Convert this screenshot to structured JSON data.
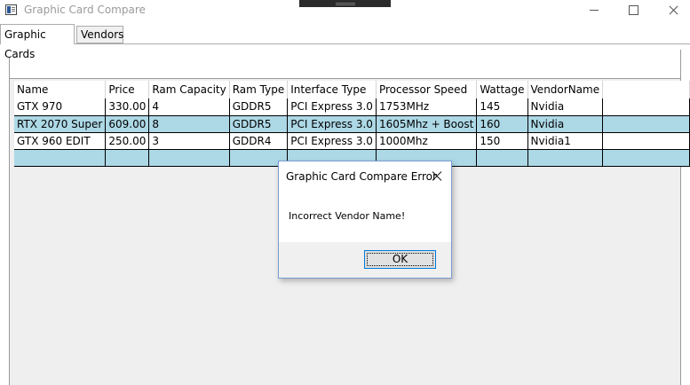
{
  "window": {
    "title": "Graphic Card Compare"
  },
  "tabs": [
    {
      "label": "Graphic Cards"
    },
    {
      "label": "Vendors"
    }
  ],
  "grid": {
    "columns": [
      "Name",
      "Price",
      "Ram Capacity",
      "Ram Type",
      "Interface Type",
      "Processor Speed",
      "Wattage",
      "VendorName"
    ],
    "rows": [
      [
        "GTX 970",
        "330.00",
        "4",
        "GDDR5",
        "PCI Express 3.0",
        "1753MHz",
        "145",
        "Nvidia"
      ],
      [
        "RTX 2070 Super",
        "609.00",
        "8",
        "GDDR5",
        "PCI Express 3.0",
        "1605Mhz + Boost",
        "160",
        "Nvidia"
      ],
      [
        "GTX 960 EDIT",
        "250.00",
        "3",
        "GDDR4",
        "PCI Express 3.0",
        "1000Mhz",
        "150",
        "Nvidia1"
      ],
      [
        "",
        "",
        "",
        "",
        "",
        "",
        "",
        ""
      ]
    ],
    "row_colors": [
      "#ffffff",
      "#add8e6"
    ]
  },
  "dialog": {
    "title": "Graphic Card Compare Error",
    "message": "Incorrect Vendor Name!",
    "ok_label": "OK"
  }
}
